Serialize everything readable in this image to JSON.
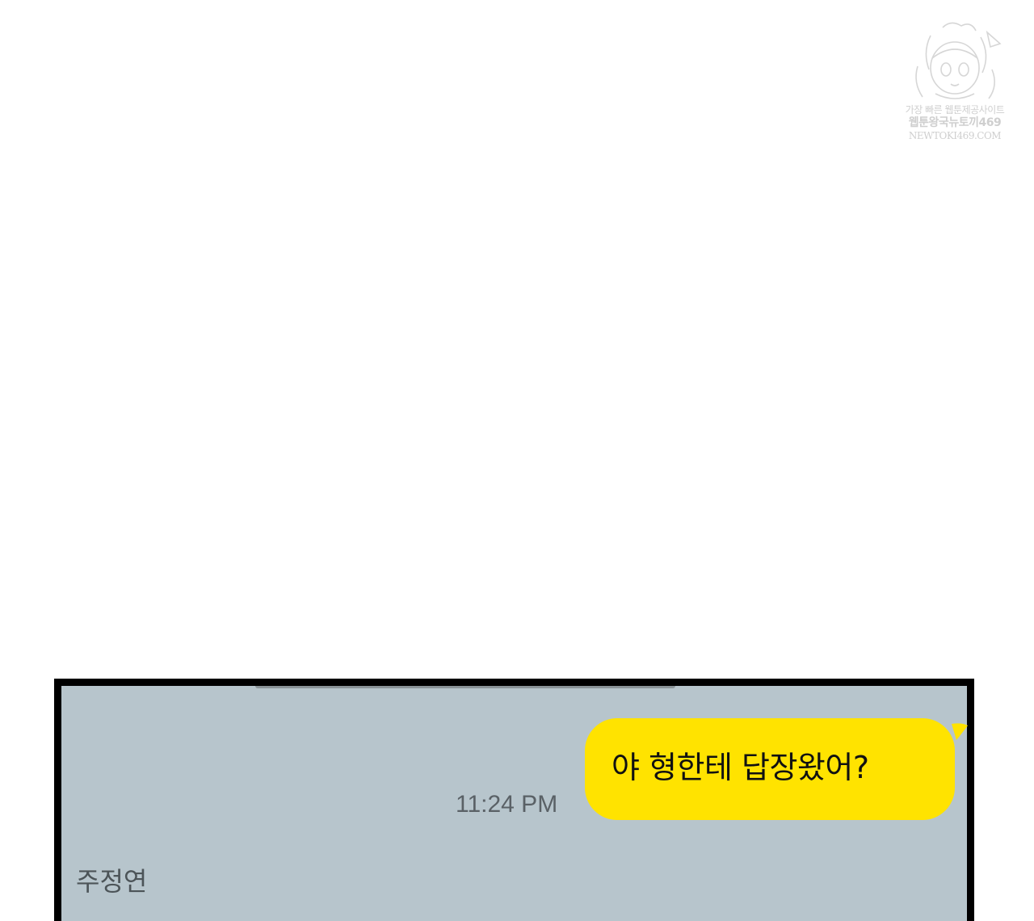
{
  "watermark": {
    "icon": "anime-girl-icon",
    "line1": "가장 빠른 웹툰제공사이트",
    "line2": "웹툰왕국뉴토끼469",
    "line3": "NEWTOKI469.COM"
  },
  "chat": {
    "messages": [
      {
        "direction": "outgoing",
        "text": "야 형한테 답장왔어?",
        "time": "11:24 PM"
      }
    ],
    "next_sender": "주정연"
  },
  "colors": {
    "chat_background": "#b7c5cc",
    "outgoing_bubble": "#ffe300",
    "frame": "#000000"
  }
}
